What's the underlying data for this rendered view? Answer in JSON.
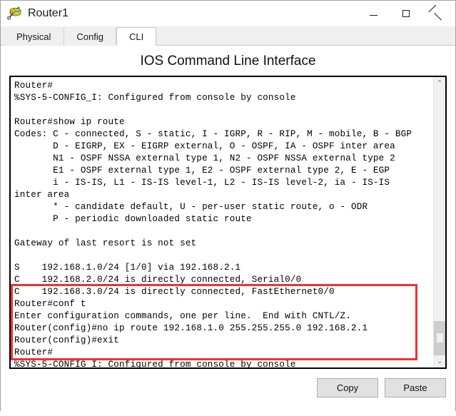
{
  "window": {
    "title": "Router1",
    "icon": "router-device-icon",
    "controls": {
      "minimize": "minimize-button",
      "maximize": "maximize-button",
      "close": "close-button"
    }
  },
  "tabs": [
    {
      "label": "Physical",
      "active": false
    },
    {
      "label": "Config",
      "active": false
    },
    {
      "label": "CLI",
      "active": true
    }
  ],
  "main": {
    "heading": "IOS Command Line Interface"
  },
  "terminal": {
    "lines": "Router#\n%SYS-5-CONFIG_I: Configured from console by console\n\nRouter#show ip route\nCodes: C - connected, S - static, I - IGRP, R - RIP, M - mobile, B - BGP\n       D - EIGRP, EX - EIGRP external, O - OSPF, IA - OSPF inter area\n       N1 - OSPF NSSA external type 1, N2 - OSPF NSSA external type 2\n       E1 - OSPF external type 1, E2 - OSPF external type 2, E - EGP\n       i - IS-IS, L1 - IS-IS level-1, L2 - IS-IS level-2, ia - IS-IS\ninter area\n       * - candidate default, U - per-user static route, o - ODR\n       P - periodic downloaded static route\n\nGateway of last resort is not set\n\nS    192.168.1.0/24 [1/0] via 192.168.2.1\nC    192.168.2.0/24 is directly connected, Serial0/0\nC    192.168.3.0/24 is directly connected, FastEthernet0/0\nRouter#conf t\nEnter configuration commands, one per line.  End with CNTL/Z.\nRouter(config)#no ip route 192.168.1.0 255.255.255.0 192.168.2.1\nRouter(config)#exit\nRouter#\n%SYS-5-CONFIG_I: Configured from console by console\n",
    "highlight_color": "#ee3137",
    "scrollbar": {
      "up_arrow": "⌃",
      "down_arrow": "⌄"
    }
  },
  "footer": {
    "copy_label": "Copy",
    "paste_label": "Paste"
  }
}
